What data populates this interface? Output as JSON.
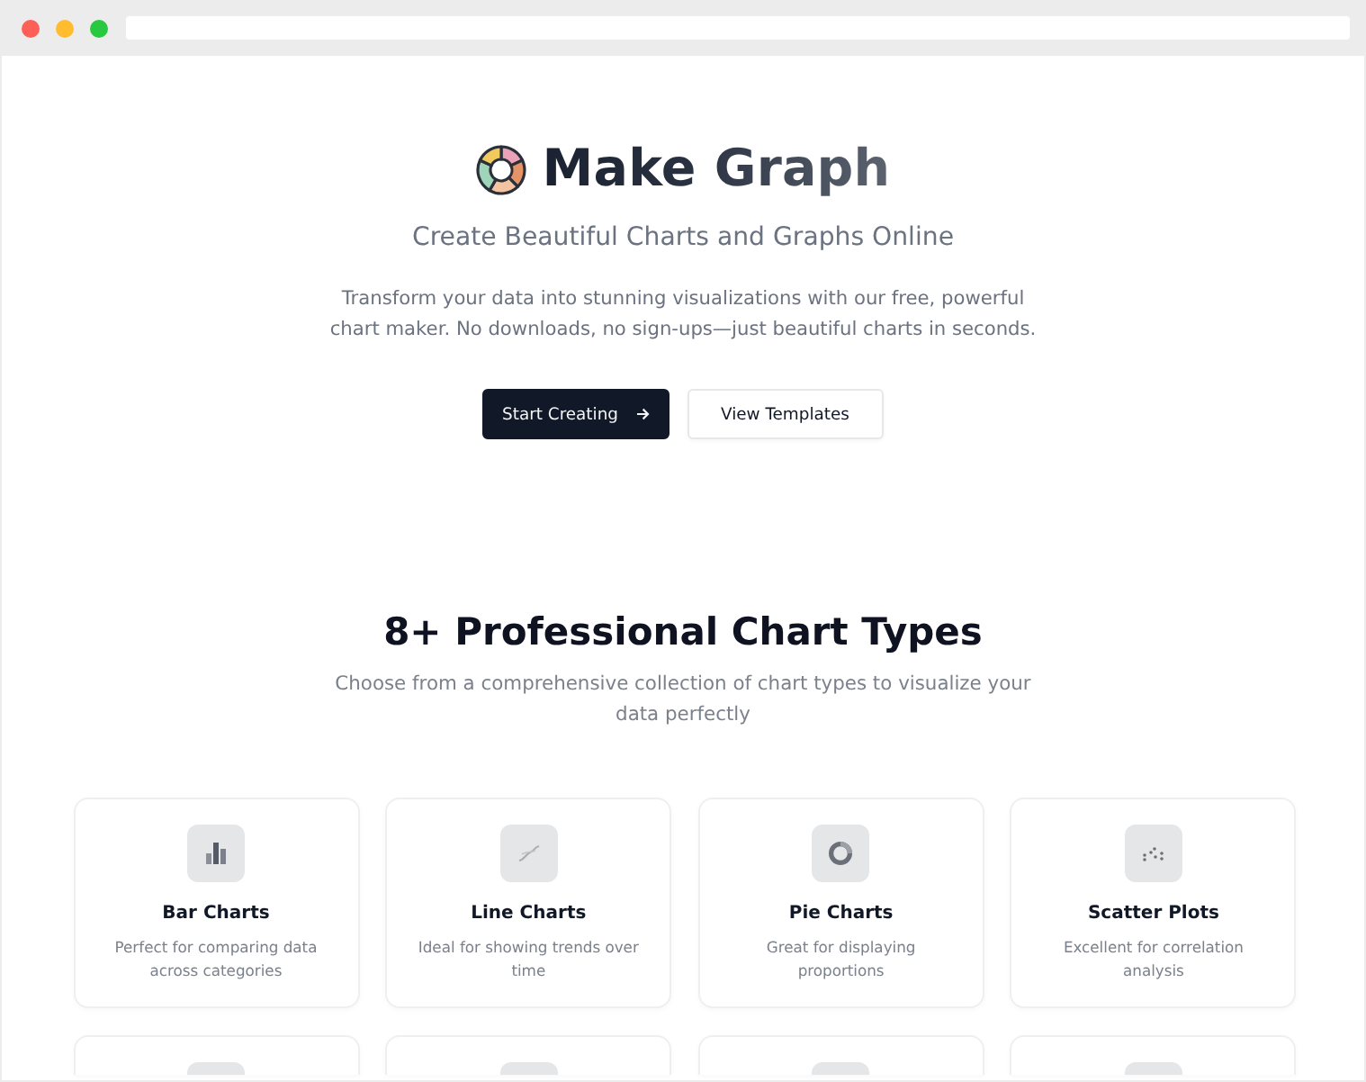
{
  "browser": {
    "window_controls": [
      {
        "color": "#fe5f57"
      },
      {
        "color": "#febc2e"
      },
      {
        "color": "#28c840"
      }
    ]
  },
  "hero": {
    "brand": "Make Graph",
    "tagline": "Create Beautiful Charts and Graphs Online",
    "description": "Transform your data into stunning visualizations with our free, powerful chart maker. No downloads, no sign-ups—just beautiful charts in seconds.",
    "buttons": [
      {
        "label": "Start Creating",
        "kind": "primary"
      },
      {
        "label": "View Templates",
        "kind": "secondary"
      }
    ]
  },
  "features": {
    "title": "8+ Professional Chart Types",
    "subtitle": "Choose from a comprehensive collection of chart types to visualize your data perfectly",
    "chart_types": [
      {
        "kind": "full",
        "title": "Bar Charts",
        "description": "Perfect for comparing data across categories"
      },
      {
        "kind": "full",
        "title": "Line Charts",
        "description": "Ideal for showing trends over time"
      },
      {
        "kind": "full",
        "title": "Pie Charts",
        "description": "Great for displaying proportions"
      },
      {
        "kind": "full",
        "title": "Scatter Plots",
        "description": "Excellent for correlation analysis"
      },
      {
        "kind": "cut"
      },
      {
        "kind": "cut"
      },
      {
        "kind": "cut"
      },
      {
        "kind": "cut"
      }
    ]
  }
}
